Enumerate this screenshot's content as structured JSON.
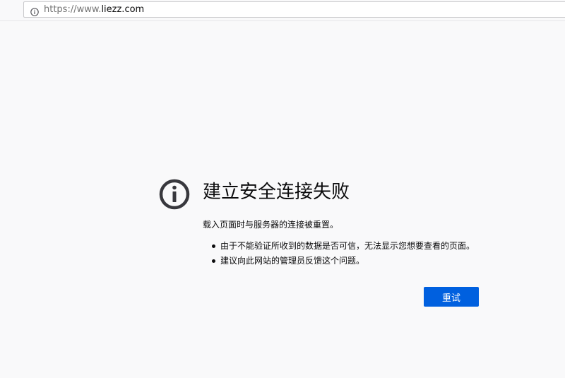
{
  "urlbar": {
    "icon": "info-icon",
    "url_prefix": "https://www.",
    "url_domain": "liezz.com"
  },
  "error": {
    "icon": "info-circle-icon",
    "title": "建立安全连接失败",
    "description": "载入页面时与服务器的连接被重置。",
    "reasons": [
      "由于不能验证所收到的数据是否可信，无法显示您想要查看的页面。",
      "建议向此网站的管理员反馈这个问题。"
    ],
    "retry_label": "重试"
  },
  "colors": {
    "background": "#f9f9fa",
    "primary_button": "#0060df",
    "icon": "#38383d"
  }
}
